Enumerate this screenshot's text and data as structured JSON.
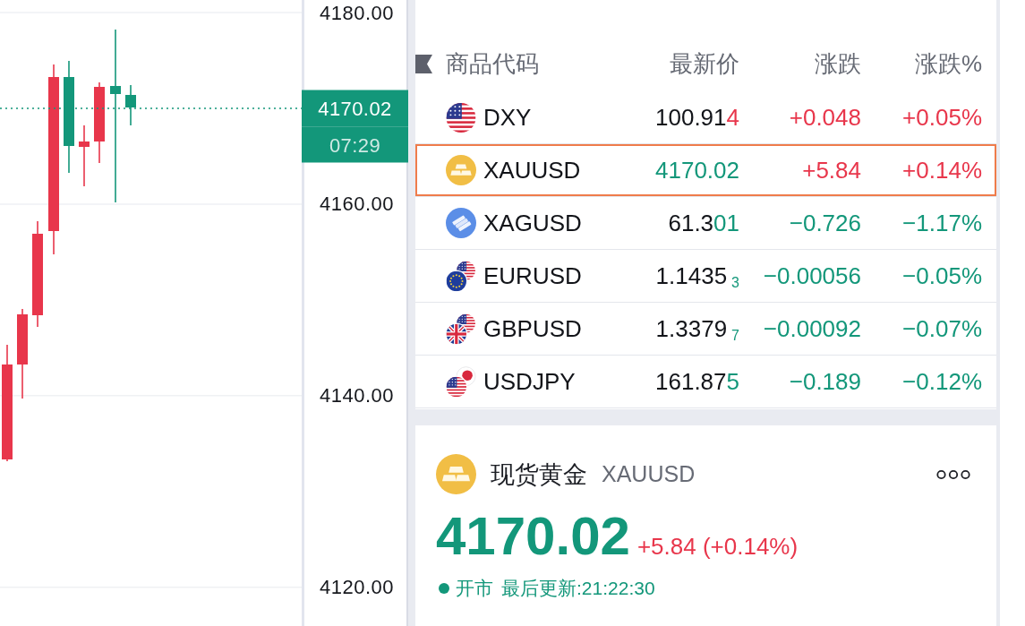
{
  "chart": {
    "axis_labels": [
      "4180.00",
      "4160.00",
      "4140.00",
      "4120.00"
    ],
    "price_tag": {
      "price": "4170.02",
      "countdown": "07:29"
    }
  },
  "watchlist": {
    "columns": [
      "商品代码",
      "最新价",
      "涨跌",
      "涨跌%"
    ],
    "rows": [
      {
        "symbol": "DXY",
        "price_parts": [
          {
            "text": "100.91",
            "color": "#121419",
            "kind": "digits"
          },
          {
            "text": "4",
            "color": "#e8364b",
            "kind": "digits"
          }
        ],
        "change": "+0.048",
        "change_pct": "+0.05%",
        "up": true,
        "selected": false
      },
      {
        "symbol": "XAUUSD",
        "price_parts": [
          {
            "text": "4170.02",
            "color": "#13977a",
            "kind": "digits"
          }
        ],
        "change": "+5.84",
        "change_pct": "+0.14%",
        "up": true,
        "selected": true
      },
      {
        "symbol": "XAGUSD",
        "price_parts": [
          {
            "text": "61.3",
            "color": "#121419",
            "kind": "digits"
          },
          {
            "text": "01",
            "color": "#13977a",
            "kind": "digits"
          }
        ],
        "change": "−0.726",
        "change_pct": "−1.17%",
        "up": false,
        "selected": false
      },
      {
        "symbol": "EURUSD",
        "price_parts": [
          {
            "text": "1.1435",
            "color": "#121419",
            "kind": "digits"
          },
          {
            "text": "3",
            "color": "#13977a",
            "kind": "pipette"
          }
        ],
        "change": "−0.00056",
        "change_pct": "−0.05%",
        "up": false,
        "selected": false
      },
      {
        "symbol": "GBPUSD",
        "price_parts": [
          {
            "text": "1.3379",
            "color": "#121419",
            "kind": "digits"
          },
          {
            "text": "7",
            "color": "#13977a",
            "kind": "pipette"
          }
        ],
        "change": "−0.00092",
        "change_pct": "−0.07%",
        "up": false,
        "selected": false
      },
      {
        "symbol": "USDJPY",
        "price_parts": [
          {
            "text": "161.87",
            "color": "#121419",
            "kind": "digits"
          },
          {
            "text": "5",
            "color": "#13977a",
            "kind": "digits"
          }
        ],
        "change": "−0.189",
        "change_pct": "−0.12%",
        "up": false,
        "selected": false
      }
    ]
  },
  "detail": {
    "name": "现货黄金",
    "symbol": "XAUUSD",
    "price": {
      "text": "4170.02",
      "color": "#13977a"
    },
    "change": "+5.84 (+0.14%)",
    "up": true,
    "market_open": true,
    "market_status": "开市",
    "last_update": "最后更新:21:22:30"
  }
}
